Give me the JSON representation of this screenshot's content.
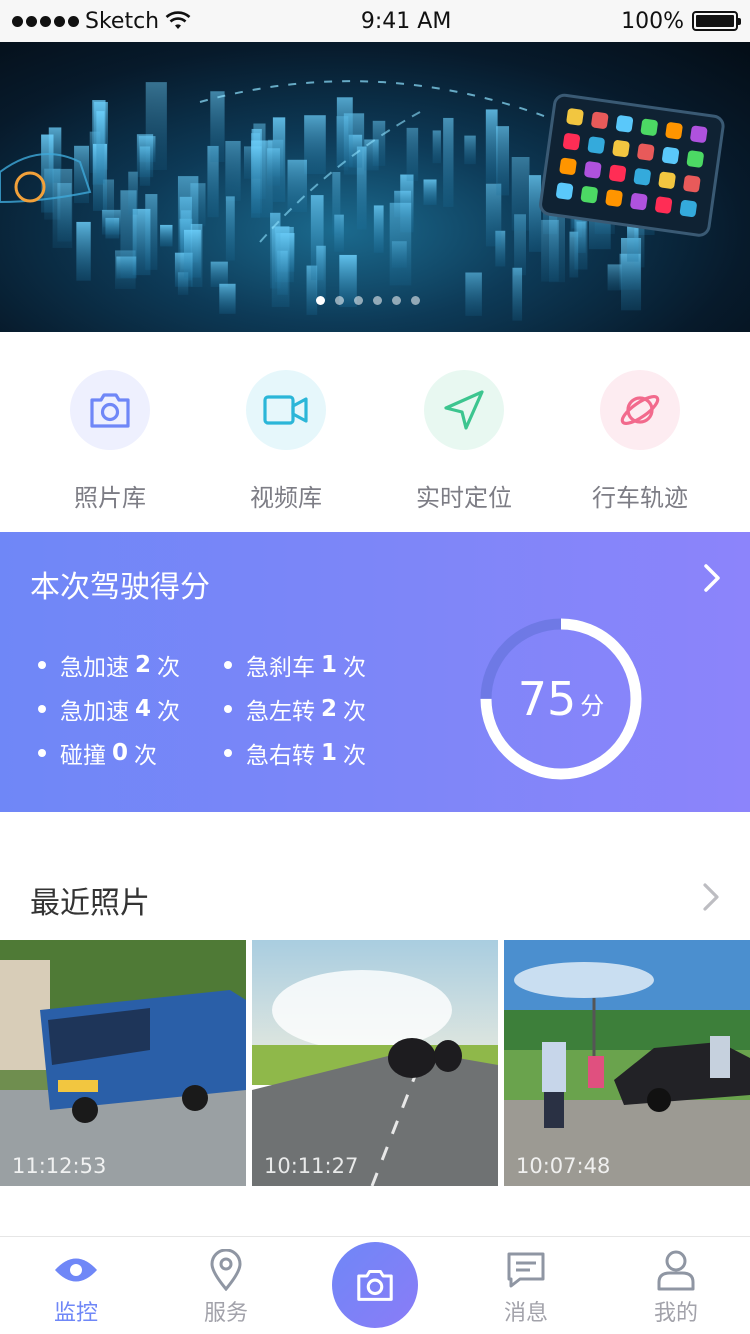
{
  "status_bar": {
    "carrier": "Sketch",
    "time": "9:41 AM",
    "battery_text": "100%"
  },
  "banner": {
    "page_dots": 6,
    "active_dot": 0
  },
  "quick_actions": [
    {
      "label": "照片库",
      "icon": "camera-icon",
      "color": "#6f87f7",
      "bg": "#eef0fe"
    },
    {
      "label": "视频库",
      "icon": "video-icon",
      "color": "#2bb6d8",
      "bg": "#e6f7fb"
    },
    {
      "label": "实时定位",
      "icon": "navigation-arrow-icon",
      "color": "#3cc58f",
      "bg": "#e8f8f1"
    },
    {
      "label": "行车轨迹",
      "icon": "planet-icon",
      "color": "#f26a8d",
      "bg": "#fdecf1"
    }
  ],
  "score_card": {
    "title": "本次驾驶得分",
    "score": "75",
    "unit": "分",
    "score_percent": 75,
    "stats": [
      {
        "name": "急加速",
        "count": "2",
        "unit": "次"
      },
      {
        "name": "急加速",
        "count": "4",
        "unit": "次"
      },
      {
        "name": "碰撞",
        "count": "0",
        "unit": "次"
      },
      {
        "name": "急刹车",
        "count": "1",
        "unit": "次"
      },
      {
        "name": "急左转",
        "count": "2",
        "unit": "次"
      },
      {
        "name": "急右转",
        "count": "1",
        "unit": "次"
      }
    ],
    "gradient_start": "#6f87f7",
    "gradient_end": "#8c84fb"
  },
  "recent_photos": {
    "title": "最近照片",
    "items": [
      {
        "time": "11:12:53",
        "scene": "bus"
      },
      {
        "time": "10:11:27",
        "scene": "road-motorcycles"
      },
      {
        "time": "10:07:48",
        "scene": "roadside-accident"
      }
    ]
  },
  "tabbar": {
    "items": [
      {
        "label": "监控",
        "icon": "eye-icon",
        "active": true
      },
      {
        "label": "服务",
        "icon": "location-pin-icon",
        "active": false
      },
      {
        "label": "消息",
        "icon": "message-icon",
        "active": false
      },
      {
        "label": "我的",
        "icon": "user-icon",
        "active": false
      }
    ],
    "center_icon": "camera-icon",
    "accent": "#6f87f7",
    "inactive": "#a2a2aa"
  }
}
